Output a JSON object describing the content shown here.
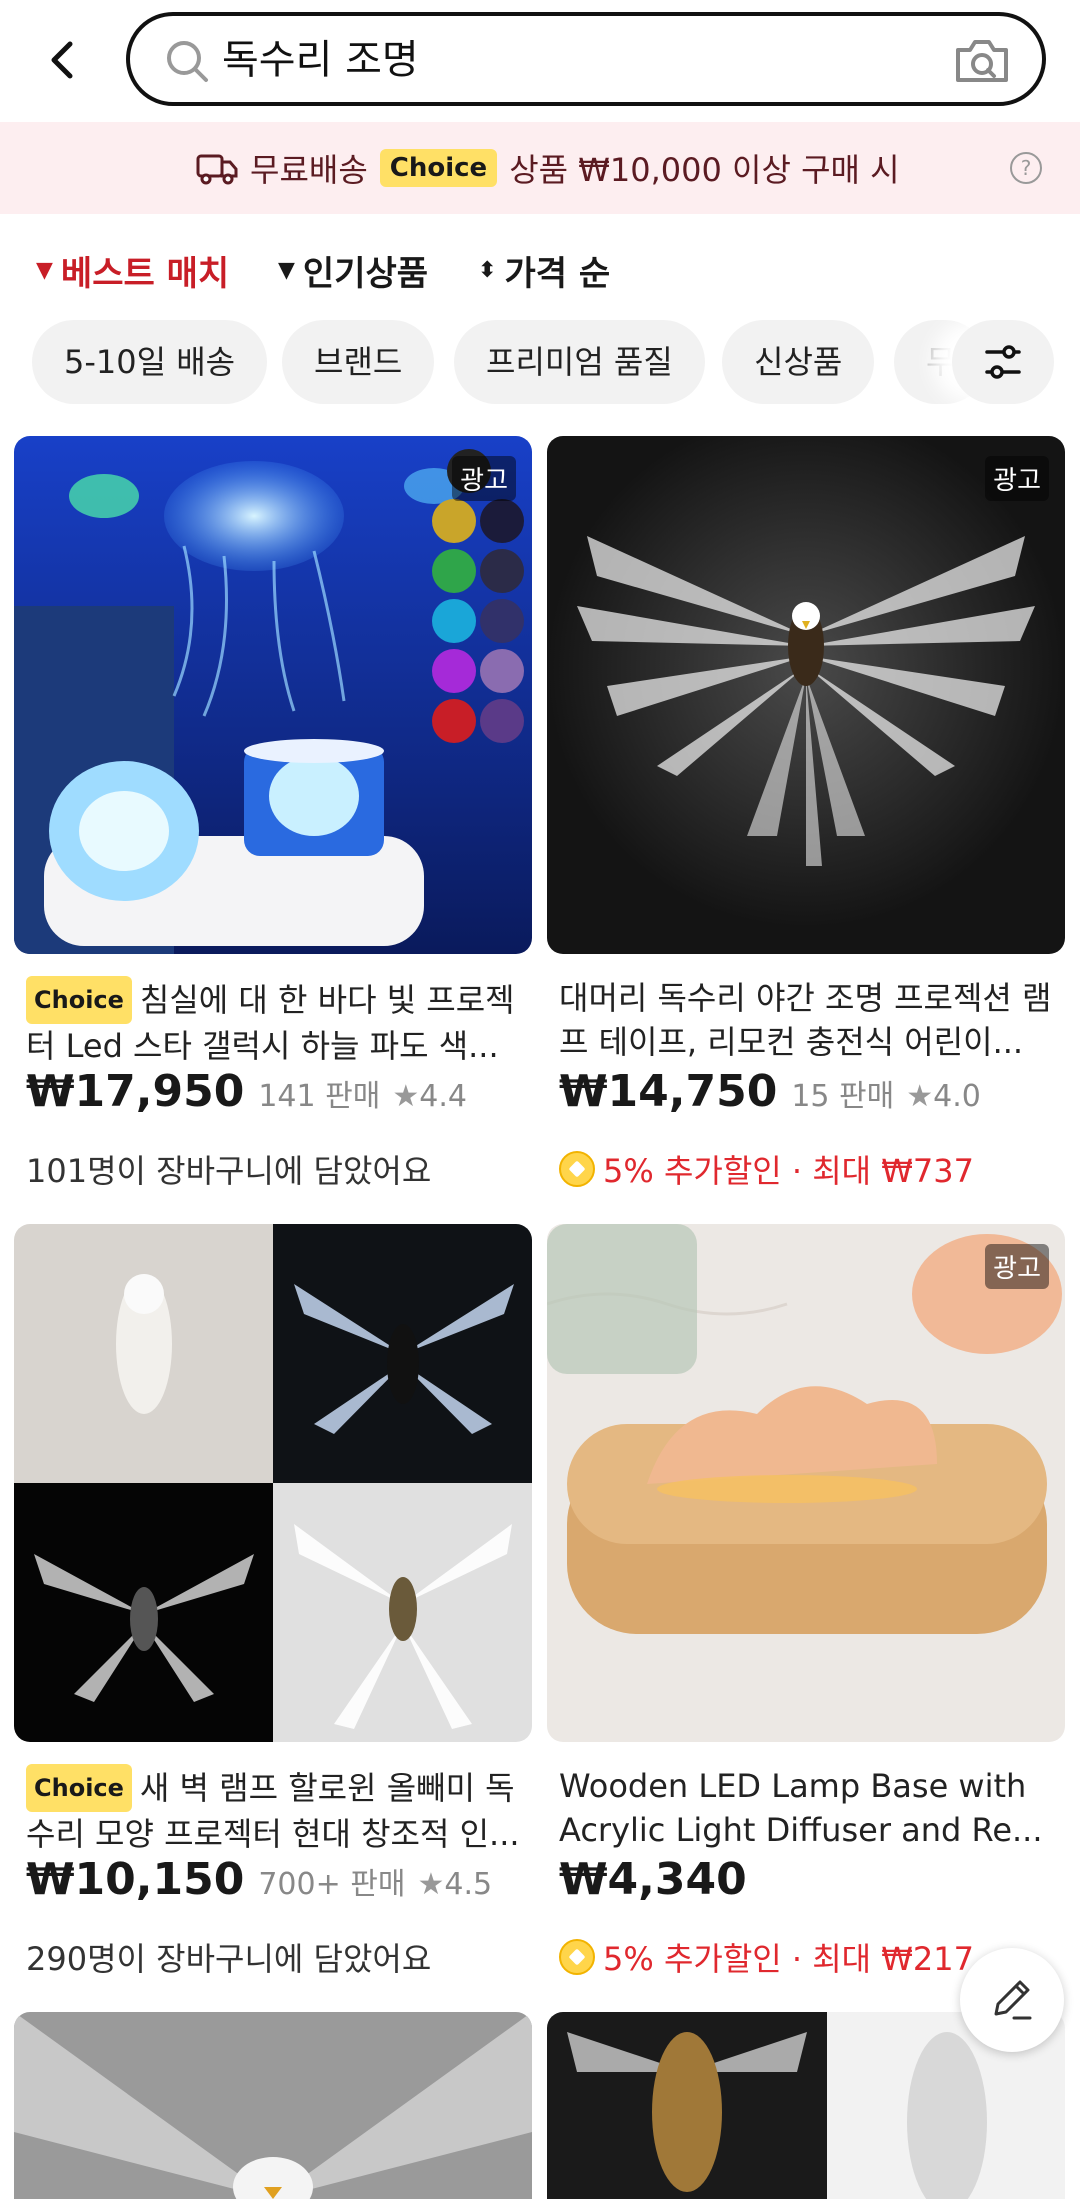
{
  "search": {
    "query": "독수리 조명"
  },
  "banner": {
    "free_shipping": "무료배송",
    "choice": "Choice",
    "condition": "상품 ₩10,000 이상 구매 시"
  },
  "sort": {
    "best_match": "베스트 매치",
    "popular": "인기상품",
    "price": "가격 순"
  },
  "filters": [
    "5-10일 배송",
    "브랜드",
    "프리미엄 품질",
    "신상품",
    "무"
  ],
  "products": [
    {
      "ad": "광고",
      "choice": "Choice",
      "title": "침실에 대 한 바다 빛 프로젝터 Led 스타 갤럭시 하늘 파도 색...",
      "price": "₩17,950",
      "sold": "141 판매",
      "rating": "4.4",
      "sub": "101명이 장바구니에 담았어요"
    },
    {
      "ad": "광고",
      "title": "대머리 독수리 야간 조명 프로젝션 램프 테이프, 리모컨 충전식 어린이...",
      "price": "₩14,750",
      "sold": "15 판매",
      "rating": "4.0",
      "discount": "5% 추가할인 · 최대 ₩737"
    },
    {
      "choice": "Choice",
      "title": "새 벽 램프 할로윈 올빼미 독수리 모양 프로젝터 현대 창조적 인...",
      "price": "₩10,150",
      "sold": "700+ 판매",
      "rating": "4.5",
      "sub": "290명이 장바구니에 담았어요"
    },
    {
      "ad": "광고",
      "title": "Wooden LED Lamp Base with Acrylic Light Diffuser and Re...",
      "price": "₩4,340",
      "discount": "5% 추가할인 · 최대 ₩217"
    }
  ]
}
